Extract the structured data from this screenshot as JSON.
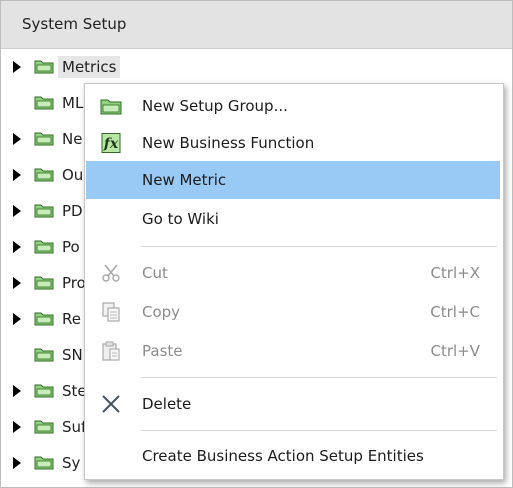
{
  "panel": {
    "title": "System Setup"
  },
  "tree": {
    "rows": [
      {
        "label": "Metrics",
        "expandable": true,
        "selected": true
      },
      {
        "label": "ML",
        "expandable": false
      },
      {
        "label": "Ne",
        "expandable": true
      },
      {
        "label": "Ou",
        "expandable": true
      },
      {
        "label": "PD",
        "expandable": true
      },
      {
        "label": "Po",
        "expandable": true
      },
      {
        "label": "Pro",
        "expandable": true
      },
      {
        "label": "Re",
        "expandable": true
      },
      {
        "label": "SN",
        "expandable": false
      },
      {
        "label": "Ste",
        "expandable": true
      },
      {
        "label": "Suf",
        "expandable": true
      },
      {
        "label": "Sy",
        "expandable": true
      }
    ]
  },
  "context_menu": {
    "items": [
      {
        "label": "New Setup Group...",
        "icon": "folder-icon",
        "shortcut": "",
        "disabled": false
      },
      {
        "label": "New Business Function",
        "icon": "function-icon",
        "shortcut": "",
        "disabled": false
      },
      {
        "label": "New Metric",
        "icon": "",
        "shortcut": "",
        "disabled": false,
        "highlighted": true
      },
      {
        "label": "Go to Wiki",
        "icon": "",
        "shortcut": "",
        "disabled": false
      },
      {
        "label": "Cut",
        "icon": "scissors-icon",
        "shortcut": "Ctrl+X",
        "disabled": true
      },
      {
        "label": "Copy",
        "icon": "copy-icon",
        "shortcut": "Ctrl+C",
        "disabled": true
      },
      {
        "label": "Paste",
        "icon": "paste-icon",
        "shortcut": "Ctrl+V",
        "disabled": true
      },
      {
        "label": "Delete",
        "icon": "delete-x-icon",
        "shortcut": "",
        "disabled": false
      },
      {
        "label": "Create Business Action Setup Entities",
        "icon": "",
        "shortcut": "",
        "disabled": false
      }
    ]
  },
  "colors": {
    "highlight": "#99c9f5",
    "folder_green": "#7fc26b",
    "header_bg": "#e3e3e3"
  }
}
